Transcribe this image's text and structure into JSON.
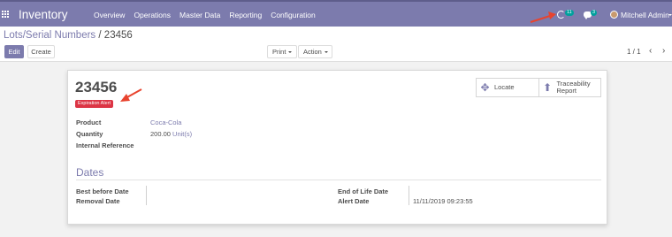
{
  "navbar": {
    "app_title": "Inventory",
    "menu": [
      "Overview",
      "Operations",
      "Master Data",
      "Reporting",
      "Configuration"
    ],
    "activity_count": "11",
    "messages_count": "3",
    "user_name": "Mitchell Admin",
    "icons": [
      "apps-icon",
      "clock-icon",
      "chat-icon",
      "avatar"
    ]
  },
  "breadcrumb": {
    "parent": "Lots/Serial Numbers",
    "separator": "/",
    "current": "23456"
  },
  "toolbar": {
    "edit_label": "Edit",
    "create_label": "Create",
    "print_label": "Print",
    "action_label": "Action"
  },
  "pager": {
    "value": "1 / 1",
    "prev": "‹",
    "next": "›"
  },
  "smart_buttons": [
    {
      "label": "Locate",
      "icon": "arrows-icon"
    },
    {
      "label": "Traceability Report",
      "icon": "arrow-up-icon"
    }
  ],
  "record": {
    "title": "23456",
    "badge": "Expiration Alert",
    "product_label": "Product",
    "product_value": "Coca-Cola",
    "quantity_label": "Quantity",
    "quantity_value": "200.00",
    "quantity_uom": "Unit(s)",
    "internal_ref_label": "Internal Reference",
    "internal_ref_value": ""
  },
  "dates": {
    "section_title": "Dates",
    "best_before_label": "Best before Date",
    "best_before_value": "",
    "removal_label": "Removal Date",
    "removal_value": "",
    "end_of_life_label": "End of Life Date",
    "end_of_life_value": "",
    "alert_label": "Alert Date",
    "alert_value": "11/11/2019 09:23:55"
  },
  "colors": {
    "brand": "#7c7bad",
    "badge": "#dc3545",
    "annotation": "#e8432e",
    "notification": "#00a09d"
  }
}
